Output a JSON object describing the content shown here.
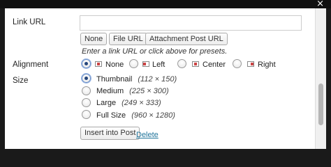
{
  "dialog": {
    "close_symbol": "×"
  },
  "link_url": {
    "label": "Link URL",
    "value": ""
  },
  "presets": {
    "none": "None",
    "file_url": "File URL",
    "attachment_post_url": "Attachment Post URL"
  },
  "hint": "Enter a link URL or click above for presets.",
  "alignment": {
    "label": "Alignment",
    "options": [
      {
        "label": "None",
        "selected": true,
        "icon": "align-none-icon"
      },
      {
        "label": "Left",
        "selected": false,
        "icon": "align-left-icon"
      },
      {
        "label": "Center",
        "selected": false,
        "icon": "align-center-icon"
      },
      {
        "label": "Right",
        "selected": false,
        "icon": "align-right-icon"
      }
    ]
  },
  "size": {
    "label": "Size",
    "options": [
      {
        "label": "Thumbnail",
        "dims": "(112 × 150)",
        "selected": true
      },
      {
        "label": "Medium",
        "dims": "(225 × 300)",
        "selected": false
      },
      {
        "label": "Large",
        "dims": "(249 × 333)",
        "selected": false
      },
      {
        "label": "Full Size",
        "dims": "(960 × 1280)",
        "selected": false
      }
    ]
  },
  "actions": {
    "insert": "Insert into Post",
    "delete": "Delete"
  }
}
